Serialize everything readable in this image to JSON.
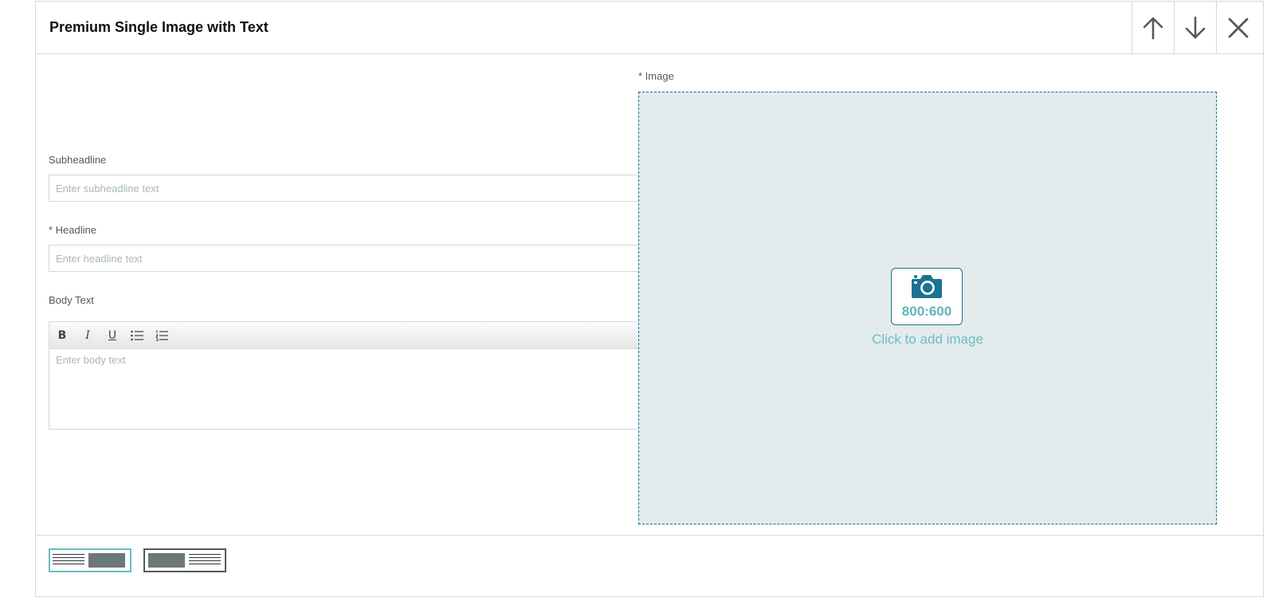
{
  "module": {
    "title": "Premium Single Image with Text",
    "move_up_icon": "arrow-up-icon",
    "move_down_icon": "arrow-down-icon",
    "remove_icon": "close-icon"
  },
  "form": {
    "subheadline": {
      "label": "Subheadline",
      "placeholder": "Enter subheadline text",
      "value": ""
    },
    "headline": {
      "label": "* Headline",
      "placeholder": "Enter headline text",
      "value": ""
    },
    "body": {
      "label": "Body Text",
      "placeholder": "Enter body text",
      "value": "",
      "toolbar": [
        {
          "name": "bold",
          "glyph": "B",
          "icon": "bold-icon"
        },
        {
          "name": "italic",
          "glyph": "I",
          "icon": "italic-icon"
        },
        {
          "name": "underline",
          "glyph": "U",
          "icon": "underline-icon"
        },
        {
          "name": "bullet-list",
          "icon": "bullet-list-icon"
        },
        {
          "name": "numbered-list",
          "icon": "numbered-list-icon"
        }
      ]
    }
  },
  "image": {
    "label": "* Image",
    "ratio": "800:600",
    "cta": "Click to add image",
    "icon": "camera-icon"
  },
  "layout_options": [
    {
      "name": "text-left-image-right",
      "selected": true
    },
    {
      "name": "image-left-text-right",
      "selected": false
    }
  ],
  "colors": {
    "accent": "#1a7391",
    "accent_light": "#6bbcc0",
    "drop_bg": "#e3ebec",
    "border": "#d5d9d9",
    "label": "#565959"
  }
}
